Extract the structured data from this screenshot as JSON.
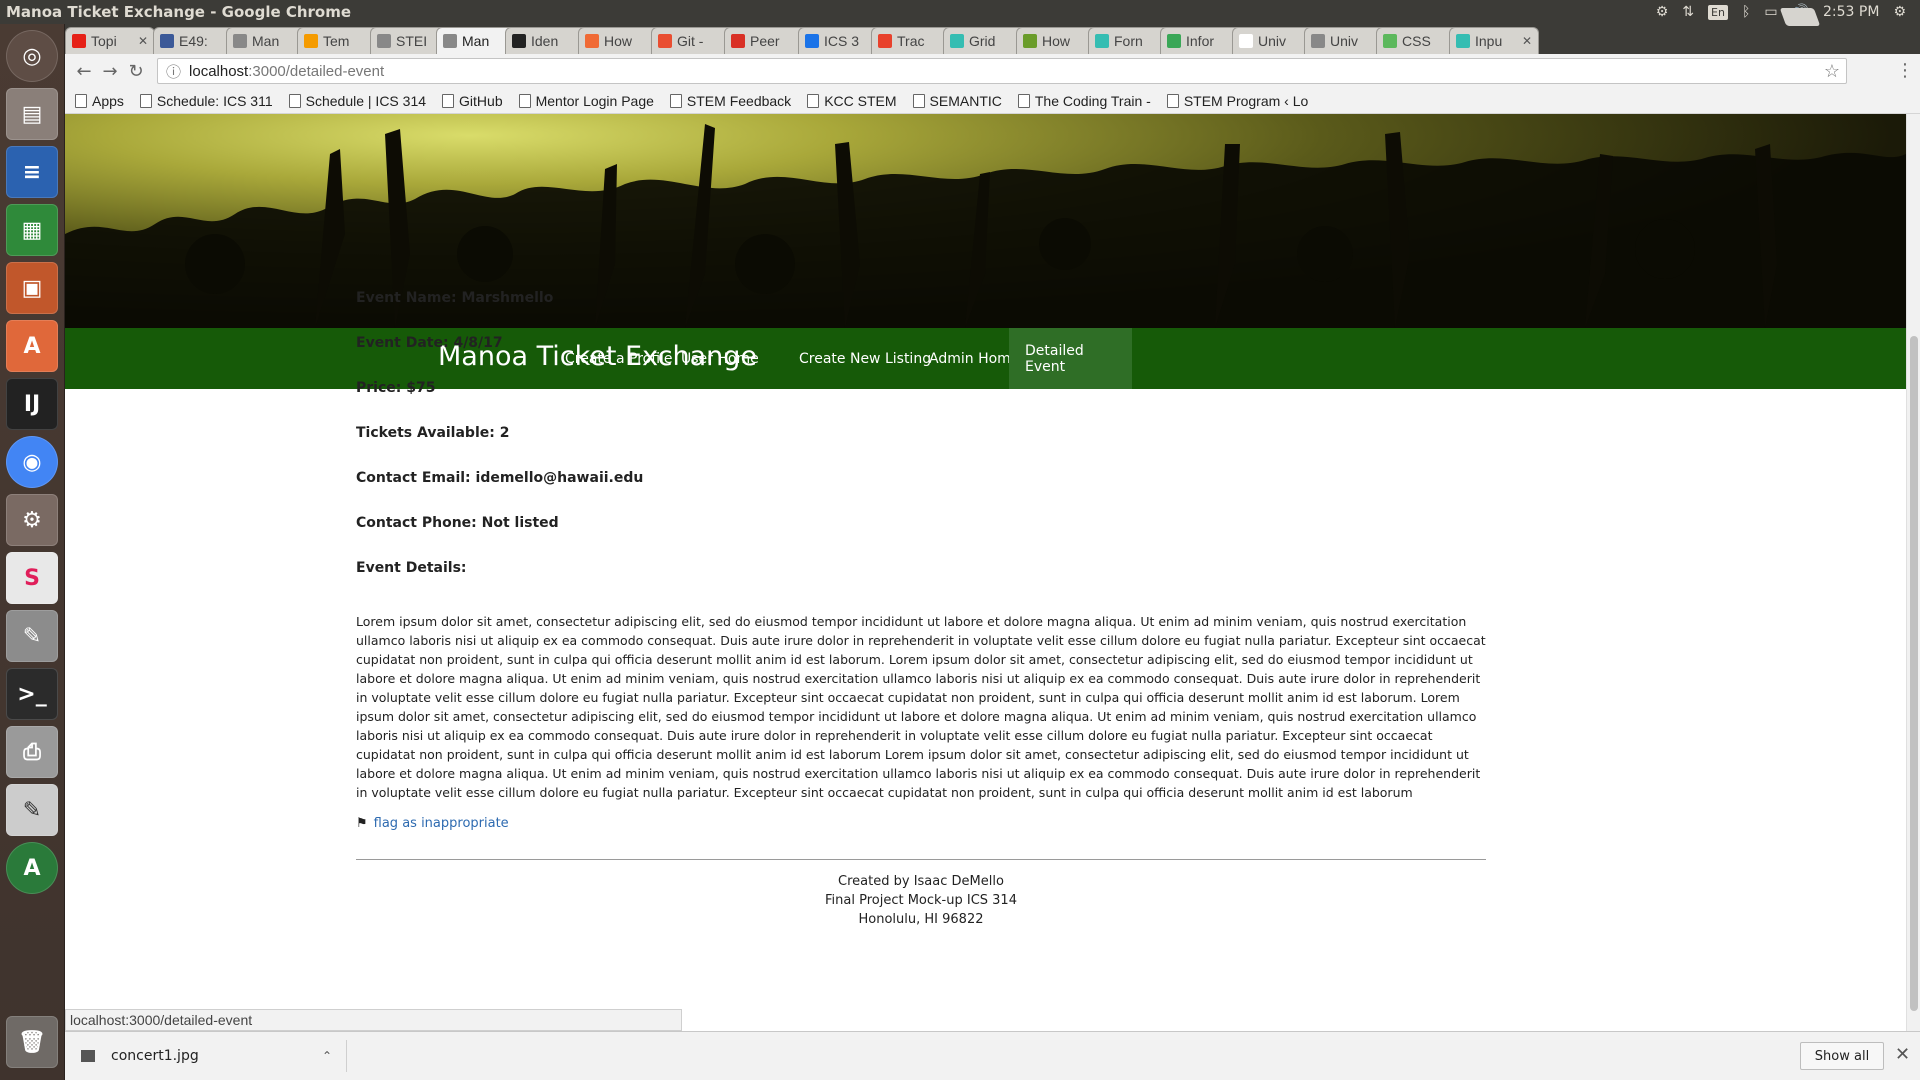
{
  "window": {
    "title": "Manoa Ticket Exchange - Google Chrome"
  },
  "tray": {
    "lang": "En",
    "clock": "2:53 PM"
  },
  "tabs": [
    {
      "label": "Topi",
      "color": "#e62117"
    },
    {
      "label": "E49:",
      "color": "#3b5998"
    },
    {
      "label": "Man",
      "color": "#888888"
    },
    {
      "label": "Tem",
      "color": "#f59b00"
    },
    {
      "label": "STEI",
      "color": "#888888"
    },
    {
      "label": "Man",
      "color": "#888888"
    },
    {
      "label": "Iden",
      "color": "#222222"
    },
    {
      "label": "How",
      "color": "#f06a35"
    },
    {
      "label": "Git -",
      "color": "#e94e31"
    },
    {
      "label": "Peer",
      "color": "#d93025"
    },
    {
      "label": "ICS 3",
      "color": "#1a73e8"
    },
    {
      "label": "Trac",
      "color": "#e8412c"
    },
    {
      "label": "Grid",
      "color": "#35bdb2"
    },
    {
      "label": "How",
      "color": "#6a9c2a"
    },
    {
      "label": "Forn",
      "color": "#35bdb2"
    },
    {
      "label": "Infor",
      "color": "#3aa757"
    },
    {
      "label": "Univ",
      "color": "#ffffff"
    },
    {
      "label": "Univ",
      "color": "#888888"
    },
    {
      "label": "CSS",
      "color": "#5cb85c"
    },
    {
      "label": "Inpu",
      "color": "#35bdb2"
    }
  ],
  "address": {
    "host": "localhost",
    "path": ":3000/detailed-event"
  },
  "bookmarks": [
    "Apps",
    "Schedule: ICS 311",
    "Schedule | ICS 314",
    "GitHub",
    "Mentor Login Page",
    "STEM Feedback",
    "KCC STEM",
    "SEMANTIC",
    "The Coding Train -",
    "STEM Program ‹ Lo"
  ],
  "nav": {
    "brand": "Manoa Ticket Exchange",
    "links": [
      "Create a Profile",
      "User Home",
      "Create New Listing",
      "Admin Home",
      "Detailed Event"
    ],
    "active": "Detailed Event"
  },
  "event": {
    "name": "Event Name: Marshmello",
    "date": "Event Date: 4/8/17",
    "price": "Price: $75",
    "tickets": "Tickets Available: 2",
    "email": "Contact Email: idemello@hawaii.edu",
    "phone": "Contact Phone: Not listed",
    "details_label": "Event Details:",
    "details": "Lorem ipsum dolor sit amet, consectetur adipiscing elit, sed do eiusmod tempor incididunt ut labore et dolore magna aliqua. Ut enim ad minim veniam, quis nostrud exercitation ullamco laboris nisi ut aliquip ex ea commodo consequat. Duis aute irure dolor in reprehenderit in voluptate velit esse cillum dolore eu fugiat nulla pariatur. Excepteur sint occaecat cupidatat non proident, sunt in culpa qui officia deserunt mollit anim id est laborum. Lorem ipsum dolor sit amet, consectetur adipiscing elit, sed do eiusmod tempor incididunt ut labore et dolore magna aliqua. Ut enim ad minim veniam, quis nostrud exercitation ullamco laboris nisi ut aliquip ex ea commodo consequat. Duis aute irure dolor in reprehenderit in voluptate velit esse cillum dolore eu fugiat nulla pariatur. Excepteur sint occaecat cupidatat non proident, sunt in culpa qui officia deserunt mollit anim id est laborum. Lorem ipsum dolor sit amet, consectetur adipiscing elit, sed do eiusmod tempor incididunt ut labore et dolore magna aliqua. Ut enim ad minim veniam, quis nostrud exercitation ullamco laboris nisi ut aliquip ex ea commodo consequat. Duis aute irure dolor in reprehenderit in voluptate velit esse cillum dolore eu fugiat nulla pariatur. Excepteur sint occaecat cupidatat non proident, sunt in culpa qui officia deserunt mollit anim id est laborum Lorem ipsum dolor sit amet, consectetur adipiscing elit, sed do eiusmod tempor incididunt ut labore et dolore magna aliqua. Ut enim ad minim veniam, quis nostrud exercitation ullamco laboris nisi ut aliquip ex ea commodo consequat. Duis aute irure dolor in reprehenderit in voluptate velit esse cillum dolore eu fugiat nulla pariatur. Excepteur sint occaecat cupidatat non proident, sunt in culpa qui officia deserunt mollit anim id est laborum",
    "flag": "flag as inappropriate"
  },
  "footer": {
    "line1": "Created by Isaac DeMello",
    "line2": "Final Project Mock-up ICS 314",
    "line3": "Honolulu, HI 96822"
  },
  "status_url": "localhost:3000/detailed-event",
  "download": {
    "file": "concert1.jpg",
    "show_all": "Show all"
  },
  "colors": {
    "navbar": "#165a08",
    "navbar_active": "#2f6e26",
    "link": "#2d6ab0"
  }
}
